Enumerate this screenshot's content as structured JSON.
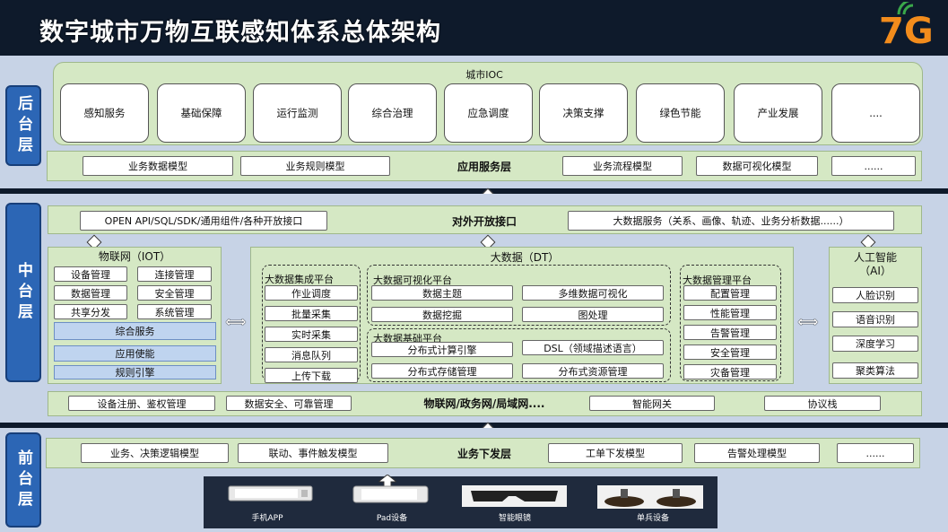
{
  "title": "数字城市万物互联感知体系总体架构",
  "logo": "7G",
  "back": {
    "tag": "后台层",
    "ioc_title": "城市IOC",
    "ioc_items": [
      "感知服务",
      "基础保障",
      "运行监测",
      "综合治理",
      "应急调度",
      "决策支撑",
      "绿色节能",
      "产业发展",
      "...."
    ],
    "service_label": "应用服务层",
    "service_items": [
      "业务数据模型",
      "业务规则模型",
      "业务流程模型",
      "数据可视化模型",
      "......"
    ]
  },
  "middle": {
    "tag": "中台层",
    "open_label": "对外开放接口",
    "open_left": "OPEN API/SQL/SDK/通用组件/各种开放接口",
    "open_right": "大数据服务（关系、画像、轨迹、业务分析数据......）",
    "iot": {
      "title": "物联网（IOT）",
      "grid": [
        "设备管理",
        "连接管理",
        "数据管理",
        "安全管理",
        "共享分发",
        "系统管理"
      ],
      "bars": [
        "综合服务",
        "应用使能",
        "规则引擎"
      ]
    },
    "dt": {
      "title": "大数据（DT）",
      "integration": {
        "title": "大数据集成平台",
        "items": [
          "作业调度",
          "批量采集",
          "实时采集",
          "消息队列",
          "上传下载"
        ]
      },
      "visual": {
        "title": "大数据可视化平台",
        "items": [
          "数据主题",
          "多维数据可视化",
          "数据挖掘",
          "图处理"
        ]
      },
      "base": {
        "title": "大数据基础平台",
        "items": [
          "分布式计算引擎",
          "DSL（领域描述语言）",
          "分布式存储管理",
          "分布式资源管理"
        ]
      },
      "manage": {
        "title": "大数据管理平台",
        "items": [
          "配置管理",
          "性能管理",
          "告警管理",
          "安全管理",
          "灾备管理"
        ]
      }
    },
    "ai": {
      "title_1": "人工智能",
      "title_2": "（AI）",
      "items": [
        "人脸识别",
        "语音识别",
        "深度学习",
        "聚类算法"
      ]
    },
    "net_label": "物联网/政务网/局域网....",
    "net_items": [
      "设备注册、鉴权管理",
      "数据安全、可靠管理",
      "智能网关",
      "协议栈"
    ]
  },
  "front": {
    "tag": "前台层",
    "label": "业务下发层",
    "items": [
      "业务、决策逻辑模型",
      "联动、事件触发模型",
      "工单下发模型",
      "告警处理模型",
      "......"
    ],
    "devices": [
      "手机APP",
      "Pad设备",
      "智能眼镜",
      "单兵设备"
    ]
  },
  "colors": {
    "header_bg": "#0e1a2b",
    "layer_bg": "#c7d3e6",
    "green": "#d5e8c4",
    "tag_blue": "#2c66b5",
    "logo_orange": "#f28c1c"
  }
}
